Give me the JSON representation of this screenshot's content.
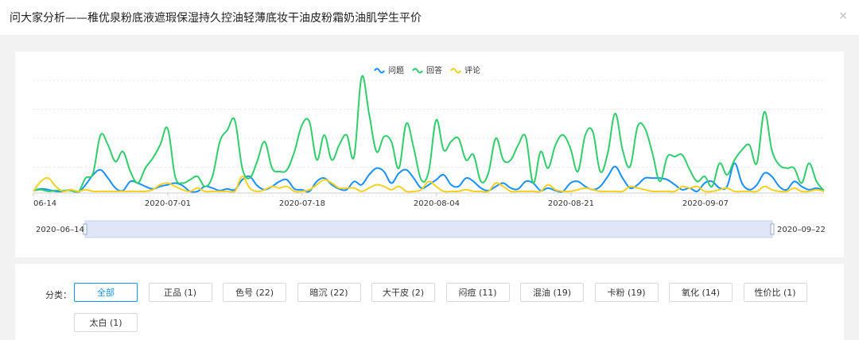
{
  "dialog": {
    "title": "问大家分析——稚优泉粉底液遮瑕保湿持久控油轻薄底妆干油皮粉霜奶油肌学生平价",
    "close_glyph": "×"
  },
  "colors": {
    "问题": "#1890ff",
    "回答": "#2fce6b",
    "评论": "#f5d020"
  },
  "chart_data": {
    "type": "line",
    "title": "",
    "xlabel": "",
    "ylabel": "",
    "x_range": [
      "2020-06-14",
      "2020-09-22"
    ],
    "x_ticks": [
      "06-14",
      "2020-07-01",
      "2020-07-18",
      "2020-08-04",
      "2020-08-21",
      "2020-09-07"
    ],
    "y_range": [
      0,
      140
    ],
    "grid": "horizontal dotted, y-axis labels hidden",
    "legend_position": "top-center",
    "series": [
      {
        "name": "问题",
        "values": [
          3,
          5,
          4,
          2,
          2,
          4,
          1,
          10,
          22,
          28,
          18,
          6,
          3,
          14,
          12,
          8,
          5,
          8,
          10,
          12,
          9,
          2,
          2,
          8,
          6,
          3,
          5,
          4,
          16,
          20,
          9,
          4,
          8,
          14,
          16,
          5,
          4,
          2,
          14,
          18,
          10,
          5,
          4,
          14,
          10,
          22,
          30,
          26,
          12,
          24,
          28,
          18,
          6,
          10,
          16,
          22,
          10,
          8,
          18,
          14,
          6,
          3,
          8,
          12,
          6,
          5,
          14,
          12,
          3,
          6,
          3,
          2,
          12,
          14,
          8,
          4,
          8,
          20,
          32,
          18,
          6,
          10,
          18,
          18,
          18,
          16,
          10,
          4,
          6,
          2,
          12,
          14,
          6,
          8,
          36,
          12,
          4,
          10,
          24,
          20,
          8,
          4,
          14,
          8,
          4,
          6,
          3
        ]
      },
      {
        "name": "回答",
        "values": [
          3,
          4,
          2,
          3,
          3,
          3,
          1,
          18,
          24,
          70,
          58,
          38,
          50,
          26,
          12,
          30,
          42,
          58,
          78,
          20,
          12,
          16,
          20,
          8,
          20,
          62,
          76,
          88,
          30,
          18,
          38,
          62,
          30,
          26,
          28,
          50,
          82,
          86,
          40,
          70,
          40,
          58,
          70,
          44,
          140,
          96,
          50,
          68,
          62,
          30,
          84,
          54,
          16,
          26,
          88,
          52,
          62,
          66,
          40,
          46,
          14,
          24,
          66,
          40,
          40,
          58,
          68,
          12,
          50,
          30,
          58,
          70,
          54,
          26,
          70,
          74,
          26,
          48,
          96,
          52,
          32,
          80,
          78,
          48,
          14,
          44,
          44,
          46,
          28,
          14,
          20,
          8,
          36,
          22,
          40,
          52,
          58,
          36,
          98,
          52,
          34,
          30,
          30,
          12,
          36,
          14,
          3
        ]
      },
      {
        "name": "评论",
        "values": [
          2,
          14,
          18,
          8,
          2,
          4,
          2,
          4,
          2,
          2,
          2,
          2,
          2,
          2,
          2,
          2,
          4,
          10,
          12,
          8,
          4,
          2,
          6,
          2,
          2,
          2,
          2,
          2,
          20,
          6,
          2,
          4,
          8,
          6,
          8,
          2,
          2,
          4,
          10,
          16,
          12,
          6,
          6,
          6,
          2,
          6,
          10,
          8,
          4,
          8,
          2,
          2,
          4,
          14,
          8,
          2,
          2,
          2,
          4,
          2,
          2,
          2,
          12,
          8,
          2,
          2,
          2,
          2,
          2,
          10,
          4,
          2,
          2,
          4,
          6,
          4,
          2,
          2,
          2,
          2,
          8,
          6,
          4,
          2,
          2,
          2,
          2,
          8,
          6,
          8,
          2,
          2,
          4,
          6,
          2,
          2,
          2,
          2,
          8,
          4,
          2,
          2,
          6,
          2,
          2,
          4,
          2
        ]
      }
    ],
    "slider": {
      "start_label": "2020–06–14",
      "end_label": "2020–09–22"
    }
  },
  "filters": {
    "label": "分类：",
    "chips": [
      {
        "label": "全部",
        "active": true
      },
      {
        "label": "正品 (1)"
      },
      {
        "label": "色号 (22)"
      },
      {
        "label": "暗沉 (22)"
      },
      {
        "label": "大干皮 (2)"
      },
      {
        "label": "闷痘 (11)"
      },
      {
        "label": "混油 (19)"
      },
      {
        "label": "卡粉 (19)"
      },
      {
        "label": "氧化 (14)"
      },
      {
        "label": "性价比 (1)"
      },
      {
        "label": "太白 (1)"
      }
    ]
  }
}
